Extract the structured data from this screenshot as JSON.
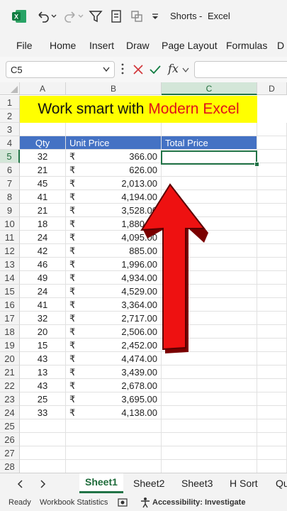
{
  "titlebar": {
    "app_name": "Excel",
    "doc_title": "Shorts",
    "separator": "-",
    "brand_color": "#217346"
  },
  "ribbon": {
    "tabs": [
      "File",
      "Home",
      "Insert",
      "Draw",
      "Page Layout",
      "Formulas",
      "D"
    ]
  },
  "formula_bar": {
    "name_box": "C5",
    "fx_label": "fx",
    "formula_value": ""
  },
  "grid": {
    "columns": [
      "A",
      "B",
      "C",
      "D"
    ],
    "selected_column": "C",
    "row_numbers": [
      1,
      2,
      3,
      4,
      5,
      6,
      7,
      8,
      9,
      10,
      11,
      12,
      13,
      14,
      15,
      16,
      17,
      18,
      19,
      20,
      21,
      22,
      23,
      24,
      25,
      26,
      27,
      28
    ],
    "selected_row": 5,
    "title": {
      "text": "Work smart with ",
      "accent": "Modern Excel",
      "fill": "#ffff00",
      "accent_color": "#e0101a"
    },
    "headers": [
      "Qty",
      "Unit Price",
      "Total Price"
    ],
    "header_fill": "#4472c4",
    "currency_symbol": "₹",
    "rows": [
      {
        "qty": "32",
        "price": "366.00"
      },
      {
        "qty": "21",
        "price": "626.00"
      },
      {
        "qty": "45",
        "price": "2,013.00"
      },
      {
        "qty": "41",
        "price": "4,194.00"
      },
      {
        "qty": "21",
        "price": "3,528.00"
      },
      {
        "qty": "18",
        "price": "1,880.00"
      },
      {
        "qty": "24",
        "price": "4,095.00"
      },
      {
        "qty": "42",
        "price": "885.00"
      },
      {
        "qty": "46",
        "price": "1,996.00"
      },
      {
        "qty": "49",
        "price": "4,934.00"
      },
      {
        "qty": "24",
        "price": "4,529.00"
      },
      {
        "qty": "41",
        "price": "3,364.00"
      },
      {
        "qty": "32",
        "price": "2,717.00"
      },
      {
        "qty": "20",
        "price": "2,506.00"
      },
      {
        "qty": "15",
        "price": "2,452.00"
      },
      {
        "qty": "43",
        "price": "4,474.00"
      },
      {
        "qty": "13",
        "price": "3,439.00"
      },
      {
        "qty": "43",
        "price": "2,678.00"
      },
      {
        "qty": "25",
        "price": "3,695.00"
      },
      {
        "qty": "33",
        "price": "4,138.00"
      }
    ]
  },
  "annotation": {
    "arrow_color": "#ee1111"
  },
  "sheet_tabs": {
    "tabs": [
      "Sheet1",
      "Sheet2",
      "Sheet3",
      "H Sort",
      "Qu"
    ],
    "active": "Sheet1"
  },
  "status_bar": {
    "ready": "Ready",
    "workbook_statistics": "Workbook Statistics",
    "accessibility": "Accessibility: Investigate"
  }
}
